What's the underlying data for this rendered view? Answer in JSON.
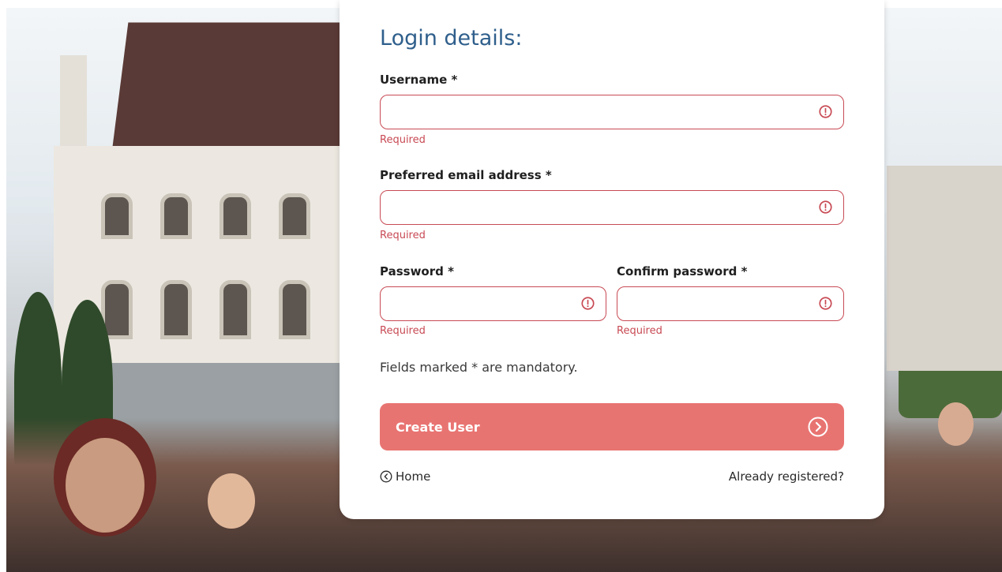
{
  "form": {
    "title": "Login details:",
    "username": {
      "label": "Username *",
      "value": "",
      "error": "Required"
    },
    "email": {
      "label": "Preferred email address *",
      "value": "",
      "error": "Required"
    },
    "password": {
      "label": "Password *",
      "value": "",
      "error": "Required"
    },
    "confirm_password": {
      "label": "Confirm password *",
      "value": "",
      "error": "Required"
    },
    "mandatory_note": "Fields marked * are mandatory.",
    "submit_label": "Create User",
    "home_link": "Home",
    "registered_link": "Already registered?"
  },
  "icons": {
    "field_error": "alert-circle-icon",
    "submit": "arrow-right-circle-icon",
    "home": "chevron-left-circle-icon"
  },
  "colors": {
    "title": "#2f5f8c",
    "error": "#c84a54",
    "button": "#e87471"
  }
}
